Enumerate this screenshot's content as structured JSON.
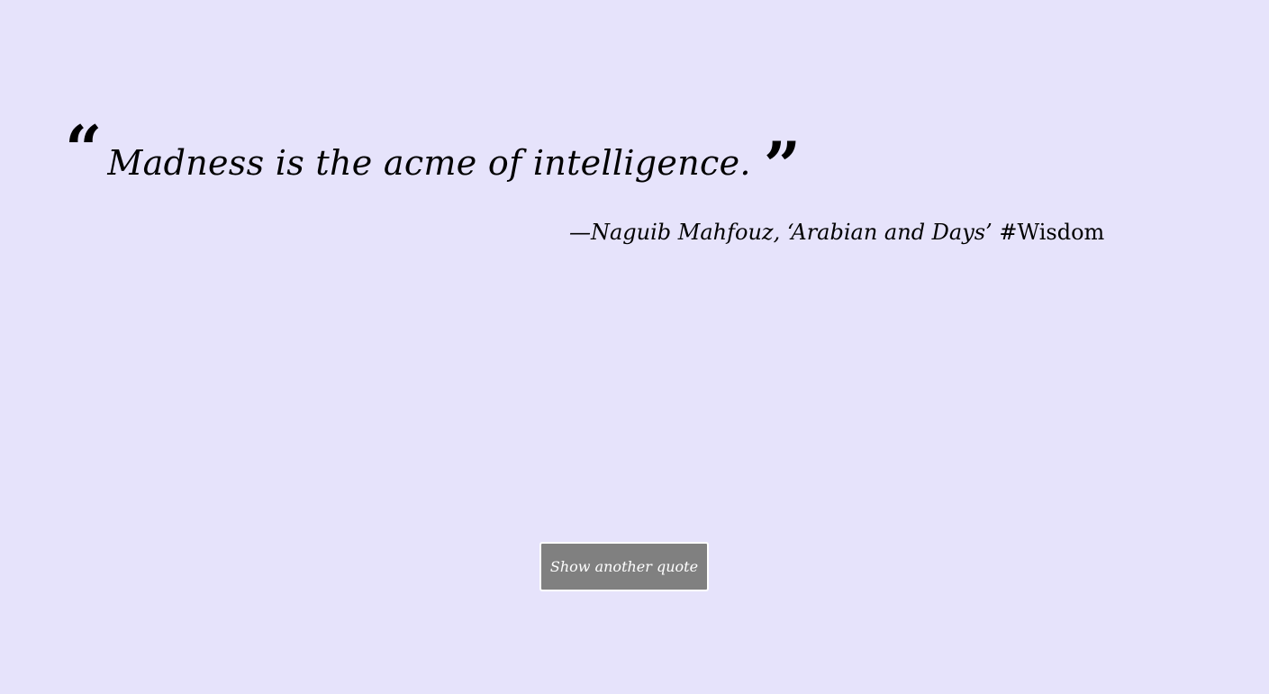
{
  "quote": {
    "open_mark": "“",
    "text": "Madness is the acme of intelligence.",
    "close_mark": "”"
  },
  "attribution": {
    "author": "—Naguib Mahfouz,",
    "source": "‘Arabian and Days’",
    "tag": "#Wisdom"
  },
  "button": {
    "label": "Show another quote"
  },
  "colors": {
    "background": "#e6e3fb",
    "button_bg": "#808080",
    "button_text": "#ffffff"
  }
}
